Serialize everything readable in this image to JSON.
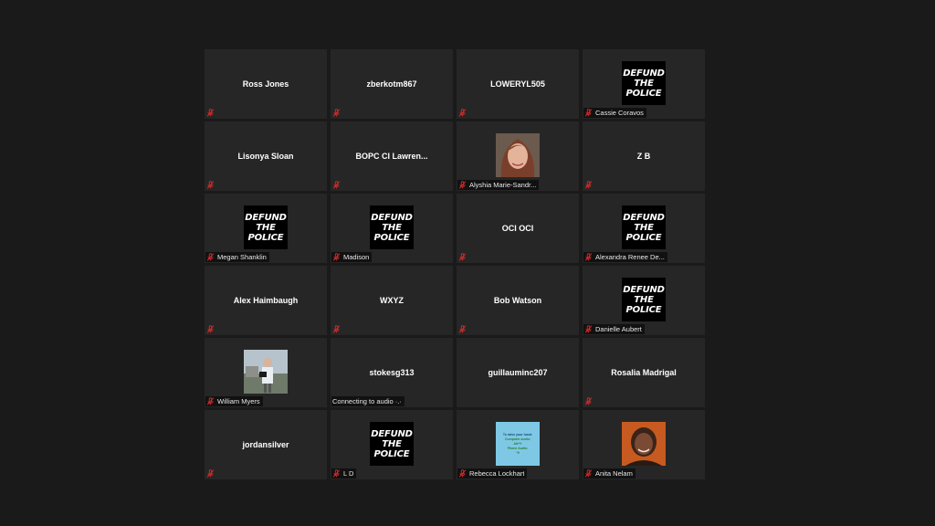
{
  "participants": [
    {
      "name": "Ross Jones",
      "muted": true
    },
    {
      "name": "zberkotm867",
      "muted": true
    },
    {
      "name": "LOWERYL505",
      "muted": true
    },
    {
      "tile": "defund",
      "label": "Cassie Coravos",
      "muted": true
    },
    {
      "name": "Lisonya Sloan",
      "muted": true
    },
    {
      "name": "BOPC CI  Lawren...",
      "muted": true
    },
    {
      "tile": "photo-woman",
      "label": "Alyshia Marie-Sandr...",
      "muted": true
    },
    {
      "name": "Z B",
      "muted": true
    },
    {
      "tile": "defund",
      "label": "Megan Shanklin",
      "muted": true
    },
    {
      "tile": "defund",
      "label": "Madison",
      "muted": true
    },
    {
      "name": "OCI OCI",
      "muted": true
    },
    {
      "tile": "defund",
      "label": "Alexandra Renee De...",
      "muted": true
    },
    {
      "name": "Alex Haimbaugh",
      "muted": true
    },
    {
      "name": "WXYZ",
      "muted": true
    },
    {
      "name": "Bob Watson",
      "muted": true
    },
    {
      "tile": "defund",
      "label": "Danielle Aubert",
      "muted": true
    },
    {
      "tile": "photo-man",
      "label": "William Myers",
      "muted": true
    },
    {
      "name": "stokesg313",
      "label": "Connecting to audio ·.·",
      "muted": false
    },
    {
      "name": "guillauminc207",
      "muted": false
    },
    {
      "name": "Rosalia Madrigal",
      "muted": true
    },
    {
      "name": "jordansilver",
      "muted": true
    },
    {
      "tile": "defund",
      "label": "L D",
      "muted": true
    },
    {
      "tile": "photo-note",
      "label": "Rebecca Lockhart",
      "muted": true
    },
    {
      "tile": "photo-woman2",
      "label": "Anita Nelam",
      "muted": true
    }
  ],
  "defund_lines": [
    "DEFUND",
    "THE",
    "POLICE"
  ],
  "note_lines": [
    "To raise your hand:",
    "Computer audio:",
    "Alt+Y",
    "Phone Audio:",
    "*9"
  ],
  "colors": {
    "tile_bg": "#262626",
    "muted_icon": "#e02828",
    "background": "#1a1a1a"
  }
}
